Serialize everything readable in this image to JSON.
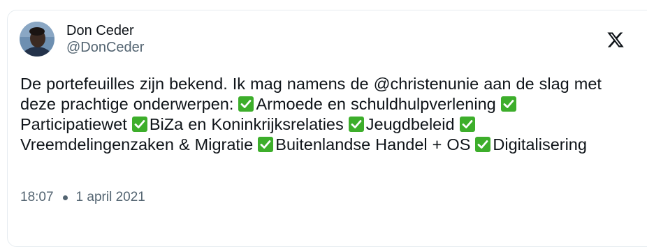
{
  "author": {
    "display_name": "Don Ceder",
    "handle": "@DonCeder",
    "avatar_icon": "profile-photo"
  },
  "platform_icon": "x-logo-icon",
  "tweet": {
    "segments": [
      {
        "type": "text",
        "value": "De portefeuilles zijn bekend. Ik mag namens de @christenunie aan de slag met deze prachtige onderwerpen: "
      },
      {
        "type": "check"
      },
      {
        "type": "text",
        "value": "Armoede en schuldhulpverlening "
      },
      {
        "type": "check"
      },
      {
        "type": "text",
        "value": "Participatiewet "
      },
      {
        "type": "check"
      },
      {
        "type": "text",
        "value": "BiZa en Koninkrijksrelaties "
      },
      {
        "type": "check"
      },
      {
        "type": "text",
        "value": "Jeugdbeleid "
      },
      {
        "type": "check"
      },
      {
        "type": "text",
        "value": "Vreemdelingenzaken & Migratie "
      },
      {
        "type": "check"
      },
      {
        "type": "text",
        "value": "Buitenlandse Handel + OS "
      },
      {
        "type": "check"
      },
      {
        "type": "text",
        "value": "Digitalisering"
      }
    ]
  },
  "meta": {
    "time": "18:07",
    "date": "1 april 2021"
  },
  "colors": {
    "check_green": "#3dae2b",
    "text_primary": "#0f1419",
    "text_secondary": "#536471",
    "border": "#e6ecf0"
  }
}
